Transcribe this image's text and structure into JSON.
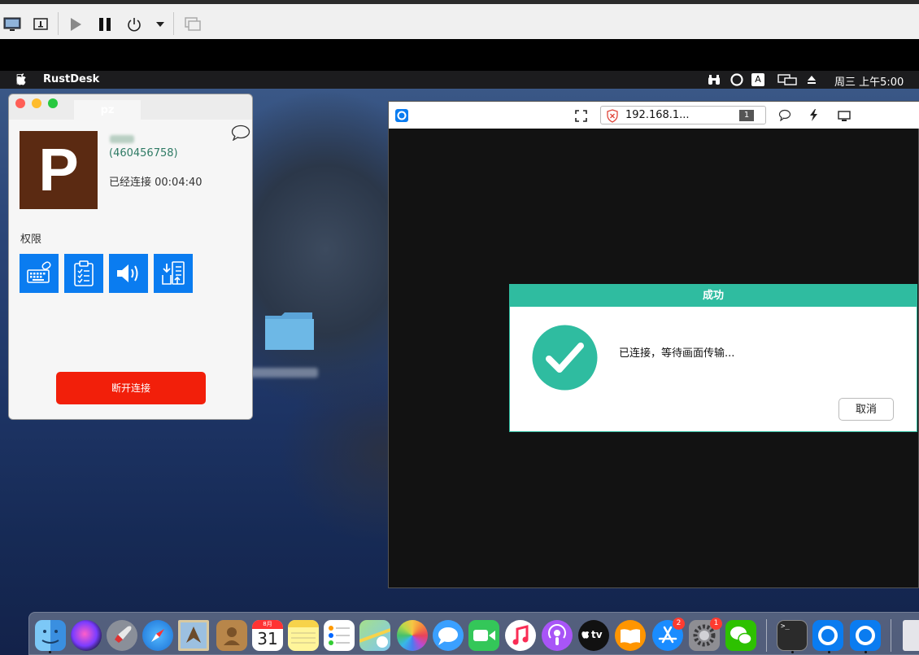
{
  "menubar": {
    "app_name": "RustDesk",
    "clock": "周三 上午5:00",
    "input_source": "A"
  },
  "cm": {
    "tab_label": "pz",
    "avatar_letter": "P",
    "peer_id": "(460456758)",
    "status": "已经连接 00:04:40",
    "permissions_label": "权限",
    "permissions": [
      {
        "name": "keyboard",
        "icon": "keyboard-icon"
      },
      {
        "name": "clipboard",
        "icon": "clipboard-icon"
      },
      {
        "name": "audio",
        "icon": "speaker-icon"
      },
      {
        "name": "file-transfer",
        "icon": "file-transfer-icon"
      }
    ],
    "disconnect_label": "断开连接"
  },
  "remote": {
    "address": "192.168.1...",
    "display_number": "1"
  },
  "dialog": {
    "title": "成功",
    "message": "已连接，等待画面传输...",
    "cancel_label": "取消"
  },
  "dock": {
    "appstore_badge": "2",
    "settings_badge": "1",
    "calendar_month": "8月",
    "calendar_day": "31",
    "tv_label": "tv"
  },
  "colors": {
    "accent": "#2fbca0",
    "permission_blue": "#0a7cf0",
    "disconnect_red": "#f21f0a",
    "avatar_brown": "#5b2a12"
  }
}
